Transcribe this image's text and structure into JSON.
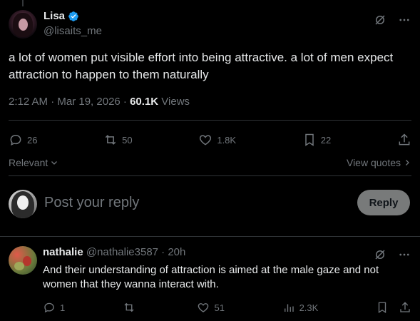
{
  "post": {
    "author_name": "Lisa",
    "author_handle": "@lisaits_me",
    "text": "a lot of women put visible effort into being attractive. a lot of men expect attraction to happen to them naturally",
    "timestamp": "2:12 AM · Mar 19, 2026 · ",
    "views_count": "60.1K",
    "views_label": " Views",
    "stats": {
      "replies": "26",
      "reposts": "50",
      "likes": "1.8K",
      "bookmarks": "22"
    }
  },
  "sort": {
    "label": "Relevant",
    "quotes_link": "View quotes"
  },
  "composer": {
    "placeholder": "Post your reply",
    "button_label": "Reply"
  },
  "reply": {
    "name": "nathalie",
    "handle_time": "@nathalie3587 · 20h",
    "text": "And their understanding of attraction is aimed at the male gaze and not women that they wanna interact with.",
    "stats": {
      "replies": "1",
      "reposts": "",
      "likes": "51",
      "views": "2.3K"
    }
  },
  "colors": {
    "background": "#000000",
    "text": "#e7e9ea",
    "muted": "#71767b",
    "verified": "#1d9bf0",
    "reply_button": "#787a7a"
  }
}
